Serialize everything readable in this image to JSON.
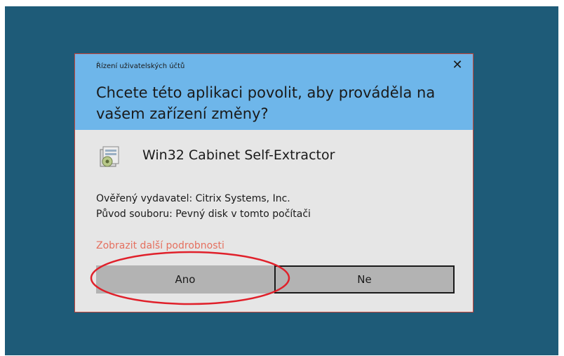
{
  "dialog": {
    "title": "Řízení uživatelských účtů",
    "close_glyph": "✕",
    "question": "Chcete této aplikaci povolit, aby prováděla na vašem zařízení změny?",
    "app_name": "Win32 Cabinet Self-Extractor",
    "publisher_line": "Ověřený vydavatel: Citrix Systems, Inc.",
    "origin_line": "Původ souboru: Pevný disk v tomto počítači",
    "details_link": "Zobrazit další podrobnosti",
    "yes_label": "Ano",
    "no_label": "Ne"
  },
  "colors": {
    "desktop": "#1e5b78",
    "header": "#6eb6ea",
    "body": "#e6e6e6",
    "link": "#e5705f",
    "annotation": "#e0202a"
  },
  "icons": {
    "app": "installer-package-icon",
    "close": "close-icon"
  }
}
